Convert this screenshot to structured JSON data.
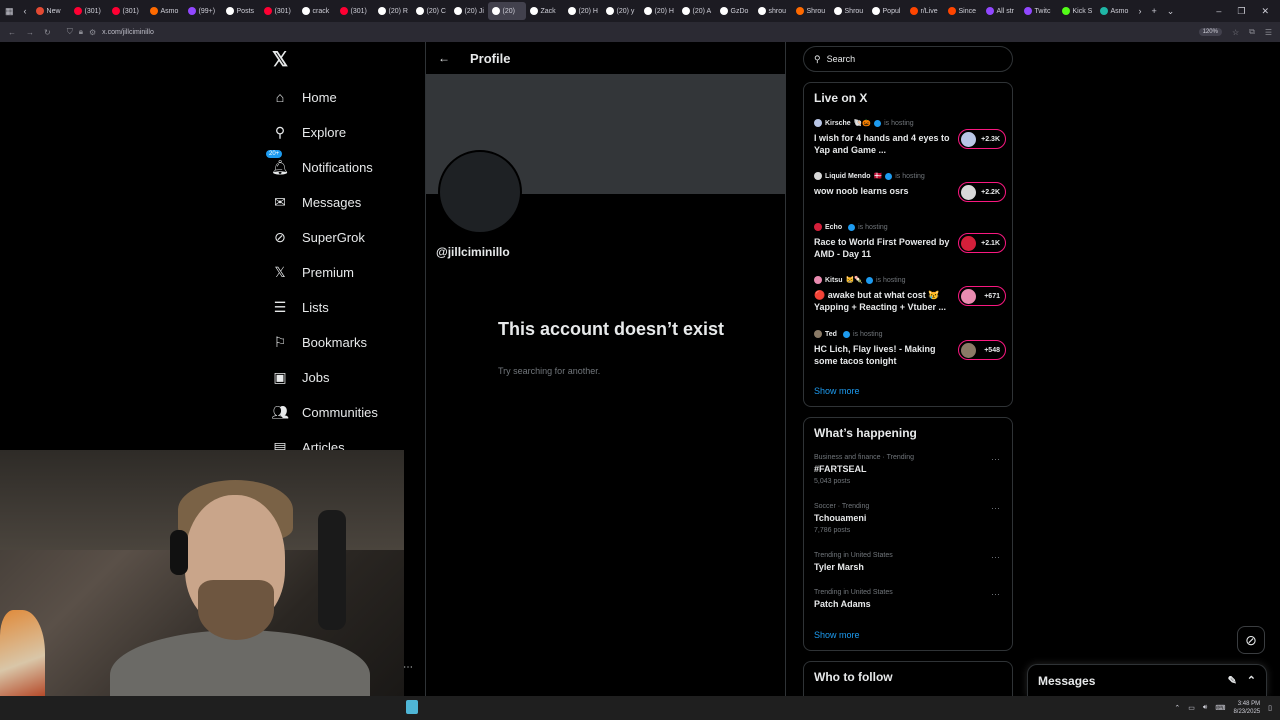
{
  "browser": {
    "tabs": [
      {
        "label": "New",
        "color": "#e34a33"
      },
      {
        "label": "(301)",
        "color": "#ff0033"
      },
      {
        "label": "(301)",
        "color": "#ff0033"
      },
      {
        "label": "Asmo",
        "color": "#ff6a00"
      },
      {
        "label": "(99+)",
        "color": "#9147ff"
      },
      {
        "label": "Posts",
        "color": "#ffffff"
      },
      {
        "label": "(301)",
        "color": "#ff0033"
      },
      {
        "label": "crack",
        "color": "#ffffff"
      },
      {
        "label": "(301)",
        "color": "#ff0033"
      },
      {
        "label": "(20) R",
        "color": "#ffffff"
      },
      {
        "label": "(20) C",
        "color": "#ffffff"
      },
      {
        "label": "(20) Ji",
        "color": "#ffffff"
      },
      {
        "label": "(20)",
        "color": "#ffffff"
      },
      {
        "label": "Zack",
        "color": "#ffffff"
      },
      {
        "label": "(20) H",
        "color": "#ffffff"
      },
      {
        "label": "(20) y",
        "color": "#ffffff"
      },
      {
        "label": "(20) H",
        "color": "#ffffff"
      },
      {
        "label": "(20) A",
        "color": "#ffffff"
      },
      {
        "label": "GzDo",
        "color": "#ffffff"
      },
      {
        "label": "shrou",
        "color": "#ffffff"
      },
      {
        "label": "Shrou",
        "color": "#ff6a00"
      },
      {
        "label": "Shrou",
        "color": "#ffffff"
      },
      {
        "label": "Popul",
        "color": "#ffffff"
      },
      {
        "label": "r/Live",
        "color": "#ff4500"
      },
      {
        "label": "Since",
        "color": "#ff4500"
      },
      {
        "label": "All str",
        "color": "#9147ff"
      },
      {
        "label": "Twitc",
        "color": "#9147ff"
      },
      {
        "label": "Kick S",
        "color": "#53fc18"
      },
      {
        "label": "Asmo",
        "color": "#1fb6a6"
      }
    ],
    "active_tab_index": 12,
    "url": "x.com/jillciminillo",
    "zoom": "120%"
  },
  "nav": {
    "items": [
      {
        "label": "Home",
        "icon": "home-icon",
        "glyph": "⌂"
      },
      {
        "label": "Explore",
        "icon": "search-icon",
        "glyph": "⚲"
      },
      {
        "label": "Notifications",
        "icon": "bell-icon",
        "glyph": "🔔︎"
      },
      {
        "label": "Messages",
        "icon": "envelope-icon",
        "glyph": "✉"
      },
      {
        "label": "SuperGrok",
        "icon": "grok-icon",
        "glyph": "⊘"
      },
      {
        "label": "Premium",
        "icon": "x-logo-icon",
        "glyph": "𝕏"
      },
      {
        "label": "Lists",
        "icon": "list-icon",
        "glyph": "☰"
      },
      {
        "label": "Bookmarks",
        "icon": "bookmark-icon",
        "glyph": "⚐"
      },
      {
        "label": "Jobs",
        "icon": "briefcase-icon",
        "glyph": "▣"
      },
      {
        "label": "Communities",
        "icon": "people-icon",
        "glyph": "👥︎"
      },
      {
        "label": "Articles",
        "icon": "article-icon",
        "glyph": "▤"
      }
    ],
    "notifications_badge": "20+"
  },
  "profile": {
    "header_title": "Profile",
    "handle": "@jillciminillo",
    "empty_title": "This account doesn’t exist",
    "empty_subtitle": "Try searching for another."
  },
  "search": {
    "placeholder": "Search"
  },
  "live": {
    "title": "Live on X",
    "items": [
      {
        "host": "Kirsche",
        "emoji": "🐚🎃",
        "hosting": "is hosting",
        "title": "I wish for 4 hands and 4 eyes to Yap and Game ...",
        "count": "+2.3K",
        "color": "#b9c6e6"
      },
      {
        "host": "Liquid Mendo",
        "emoji": "🇩🇰",
        "hosting": "is hosting",
        "title": "wow noob learns osrs",
        "count": "+2.2K",
        "color": "#d8d8d8"
      },
      {
        "host": "Echo",
        "emoji": "",
        "hosting": "is hosting",
        "title": "Race to World First Powered by AMD - Day 11",
        "count": "+2.1K",
        "color": "#d41f3a"
      },
      {
        "host": "Kitsu",
        "emoji": "😸🍡",
        "hosting": "is hosting",
        "title": "🔴 awake but at what cost 😿 Yapping + Reacting + Vtuber ...",
        "count": "+671",
        "color": "#e98bb0"
      },
      {
        "host": "Ted",
        "emoji": "",
        "hosting": "is hosting",
        "title": "HC Lich, Flay lives! - Making some tacos tonight",
        "count": "+548",
        "color": "#8a7a66"
      }
    ],
    "show_more": "Show more"
  },
  "happening": {
    "title": "What’s happening",
    "items": [
      {
        "category": "Business and finance · Trending",
        "name": "#FARTSEAL",
        "posts": "5,043 posts"
      },
      {
        "category": "Soccer · Trending",
        "name": "Tchouameni",
        "posts": "7,786 posts"
      },
      {
        "category": "Trending in United States",
        "name": "Tyler Marsh",
        "posts": ""
      },
      {
        "category": "Trending in United States",
        "name": "Patch Adams",
        "posts": ""
      }
    ],
    "show_more": "Show more"
  },
  "who_to_follow": {
    "title": "Who to follow"
  },
  "messages_drawer": {
    "title": "Messages"
  },
  "taskbar": {
    "time": "3:48 PM",
    "date": "8/23/2025"
  },
  "colors": {
    "accent": "#1d9bf0",
    "live_border": "#f91880",
    "border": "#2f3336",
    "muted": "#71767b"
  }
}
